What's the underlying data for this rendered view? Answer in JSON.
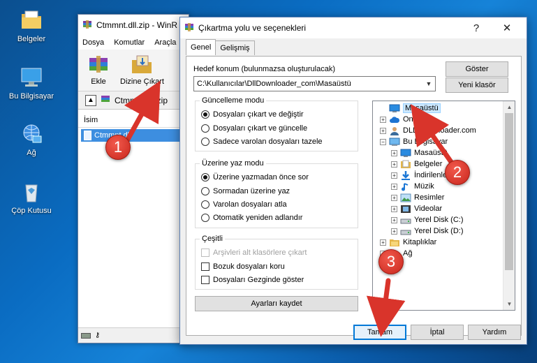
{
  "desktop": {
    "icons": [
      {
        "label": "Belgeler",
        "icon": "folder-icon"
      },
      {
        "label": "Bu Bilgisayar",
        "icon": "computer-icon"
      },
      {
        "label": "Ağ",
        "icon": "network-icon"
      },
      {
        "label": "Çöp Kutusu",
        "icon": "recycle-bin-icon"
      }
    ]
  },
  "background_window": {
    "title": "Ctmmnt.dll.zip - WinR",
    "menu": [
      "Dosya",
      "Komutlar",
      "Araçla"
    ],
    "toolbar": {
      "extract_label": "Ekle",
      "extract_to_label": "Dizine Çıkart"
    },
    "address": "Ctmmnt.dll.zip",
    "column_name": "İsim",
    "file": "Ctmmnt.dll"
  },
  "dialog": {
    "title": "Çıkartma yolu ve seçenekleri",
    "help_glyph": "?",
    "close_glyph": "✕",
    "tabs": [
      "Genel",
      "Gelişmiş"
    ],
    "target_label": "Hedef konum (bulunmazsa oluşturulacak)",
    "target_value": "C:\\Kullanıcılar\\DllDownloader_com\\Masaüstü",
    "show_button": "Göster",
    "new_folder_button": "Yeni klasör",
    "update_mode": {
      "title": "Güncelleme modu",
      "options": [
        "Dosyaları çıkart ve değiştir",
        "Dosyaları çıkart ve güncelle",
        "Sadece varolan dosyaları tazele"
      ],
      "selected": 0
    },
    "overwrite_mode": {
      "title": "Üzerine yaz modu",
      "options": [
        "Üzerine yazmadan önce sor",
        "Sormadan üzerine yaz",
        "Varolan dosyaları atla",
        "Otomatik yeniden adlandır"
      ],
      "selected": 0
    },
    "misc": {
      "title": "Çeşitli",
      "options": [
        "Arşivleri alt klasörlere çıkart",
        "Bozuk dosyaları koru",
        "Dosyaları Gezginde göster"
      ],
      "disabled": [
        true,
        false,
        false
      ],
      "checked": [
        false,
        false,
        false
      ]
    },
    "save_settings_button": "Ayarları kaydet",
    "tree": [
      {
        "label": "Masaüstü",
        "icon": "desktop-icon",
        "expander": "",
        "selected": true
      },
      {
        "label": "OneDrive",
        "icon": "cloud-icon",
        "expander": "+"
      },
      {
        "label": "DLL Downloader.com",
        "icon": "user-icon",
        "expander": "+"
      },
      {
        "label": "Bu Bilgisayar",
        "icon": "computer-icon",
        "expander": "−"
      },
      {
        "label": "Masaüstü",
        "icon": "desktop-icon",
        "expander": "+"
      },
      {
        "label": "Belgeler",
        "icon": "documents-icon",
        "expander": "+"
      },
      {
        "label": "İndirilenler",
        "icon": "download-icon",
        "expander": "+"
      },
      {
        "label": "Müzik",
        "icon": "music-icon",
        "expander": "+"
      },
      {
        "label": "Resimler",
        "icon": "pictures-icon",
        "expander": "+"
      },
      {
        "label": "Videolar",
        "icon": "video-icon",
        "expander": "+"
      },
      {
        "label": "Yerel Disk (C:)",
        "icon": "drive-icon",
        "expander": "+"
      },
      {
        "label": "Yerel Disk (D:)",
        "icon": "drive-icon",
        "expander": "+"
      },
      {
        "label": "Kitaplıklar",
        "icon": "library-icon",
        "expander": "+"
      },
      {
        "label": "Ağ",
        "icon": "network-icon",
        "expander": "+"
      }
    ],
    "ok_button": "Tamam",
    "cancel_button": "İptal",
    "help_button": "Yardım"
  },
  "callouts": [
    "1",
    "2",
    "3"
  ],
  "colors": {
    "callout": "#d9342b",
    "selection": "#cce8ff",
    "default_button_border": "#0078d7"
  }
}
